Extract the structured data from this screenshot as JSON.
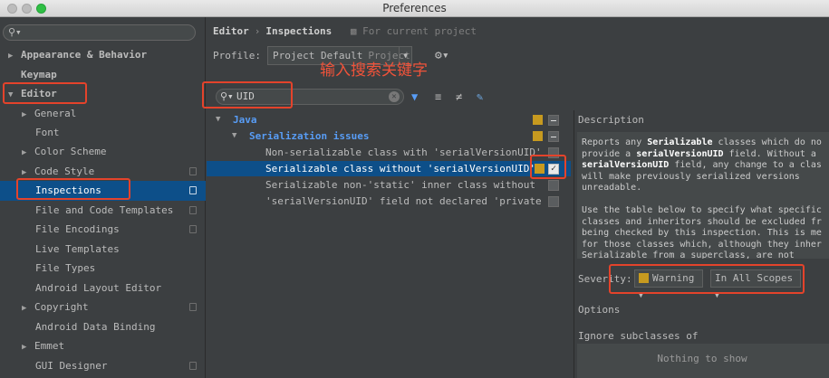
{
  "window": {
    "title": "Preferences"
  },
  "sidebar": {
    "search_placeholder": "",
    "items": [
      {
        "label": "Appearance & Behavior"
      },
      {
        "label": "Keymap"
      },
      {
        "label": "Editor"
      },
      {
        "label": "General"
      },
      {
        "label": "Font"
      },
      {
        "label": "Color Scheme"
      },
      {
        "label": "Code Style"
      },
      {
        "label": "Inspections"
      },
      {
        "label": "File and Code Templates"
      },
      {
        "label": "File Encodings"
      },
      {
        "label": "Live Templates"
      },
      {
        "label": "File Types"
      },
      {
        "label": "Android Layout Editor"
      },
      {
        "label": "Copyright"
      },
      {
        "label": "Android Data Binding"
      },
      {
        "label": "Emmet"
      },
      {
        "label": "GUI Designer"
      }
    ]
  },
  "header": {
    "breadcrumb_editor": "Editor",
    "breadcrumb_sep": "›",
    "breadcrumb_inspections": "Inspections",
    "for_current_project": "For current project",
    "profile_label": "Profile:",
    "profile_value": "Project Default",
    "profile_scope": "Project"
  },
  "annotation": "输入搜索关键字",
  "search": {
    "value": "UID"
  },
  "inspections": {
    "java": "Java",
    "serialization": "Serialization issues",
    "items": [
      {
        "label": "Non-serializable class with 'serialVersionUID'"
      },
      {
        "label": "Serializable class without 'serialVersionUID'"
      },
      {
        "label": "Serializable non-'static' inner class without"
      },
      {
        "label": "'serialVersionUID' field not declared 'private"
      }
    ]
  },
  "description": {
    "header": "Description",
    "p1_lines": [
      [
        "Reports any ",
        "Serializable",
        " classes which do no"
      ],
      [
        "provide a ",
        "serialVersionUID",
        " field. Without a"
      ],
      [
        "",
        "serialVersionUID",
        " field, any change to a clas"
      ],
      [
        "will make previously serialized versions",
        "",
        ""
      ],
      [
        "unreadable.",
        "",
        ""
      ]
    ],
    "p2_lines": [
      "Use the table below to specify what specific",
      "classes and inheritors should be excluded fr",
      "being checked by this inspection. This is me",
      "for those classes which, although they inher",
      "Serializable from a superclass, are not"
    ]
  },
  "severity": {
    "label": "Severity:",
    "value": "Warning",
    "scope": "In All Scopes"
  },
  "options": {
    "label": "Options",
    "ignore_label": "Ignore subclasses of",
    "empty_text": "Nothing to show"
  },
  "colors": {
    "accent_selection": "#0d4f89",
    "highlight": "#e4432b",
    "severity_warning": "#c79a1f",
    "java": "#589df6"
  }
}
